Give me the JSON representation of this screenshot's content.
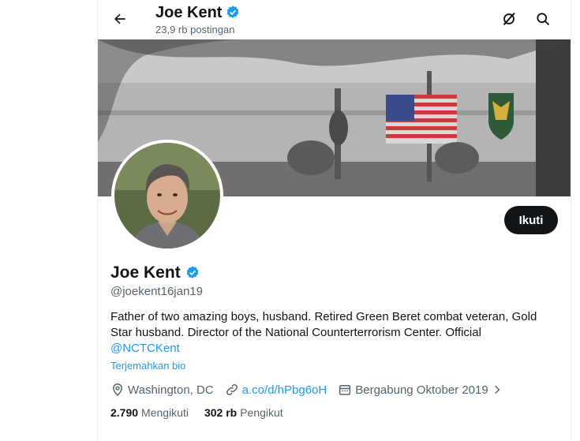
{
  "header": {
    "name": "Joe Kent",
    "post_count": "23,9 rb postingan"
  },
  "profile": {
    "name": "Joe Kent",
    "handle": "@joekent16jan19",
    "bio_text": "Father of two amazing boys, husband. Retired Green Beret combat veteran, Gold Star husband. Director of the National Counterterrorism Center. Official ",
    "bio_mention": "@NCTCKent",
    "translate_label": "Terjemahkan bio",
    "location": "Washington, DC",
    "website": "a.co/d/hPbg6oH",
    "joined": "Bergabung Oktober 2019",
    "following_count": "2.790",
    "following_label": "Mengikuti",
    "followers_count": "302 rb",
    "followers_label": "Pengikut",
    "follow_button": "Ikuti"
  },
  "colors": {
    "accent": "#1d9bf0",
    "verified": "#1d9bf0",
    "text_primary": "#0f1419",
    "text_secondary": "#536471",
    "button_bg": "#0f1419"
  },
  "icons": [
    "back-arrow-icon",
    "verified-badge-icon",
    "grok-icon",
    "search-icon",
    "location-icon",
    "link-icon",
    "calendar-icon",
    "chevron-right-icon"
  ]
}
